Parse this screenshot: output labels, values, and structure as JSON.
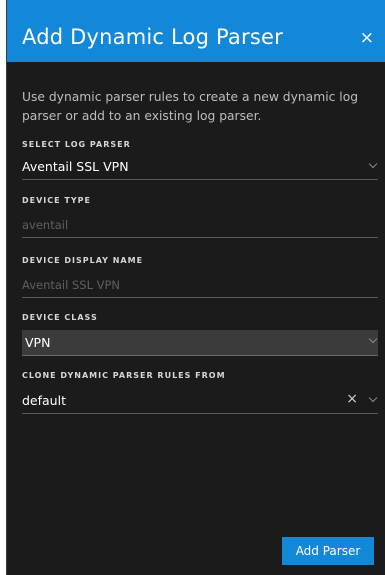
{
  "dialog": {
    "title": "Add Dynamic Log Parser",
    "close_icon": "×",
    "description": "Use dynamic parser rules to create a new dynamic log parser or add to an existing log parser."
  },
  "fields": {
    "select_log_parser": {
      "label": "SELECT LOG PARSER",
      "value": "Aventail SSL VPN"
    },
    "device_type": {
      "label": "DEVICE TYPE",
      "placeholder": "aventail"
    },
    "device_display_name": {
      "label": "DEVICE DISPLAY NAME",
      "placeholder": "Aventail SSL VPN"
    },
    "device_class": {
      "label": "DEVICE CLASS",
      "value": "VPN"
    },
    "clone_rules_from": {
      "label": "CLONE DYNAMIC PARSER RULES FROM",
      "value": "default",
      "clear_icon": "×"
    }
  },
  "actions": {
    "add_parser_label": "Add Parser"
  },
  "colors": {
    "accent": "#1488d8",
    "background": "#1b1b1b",
    "disabled_field": "#3b3b3b"
  }
}
